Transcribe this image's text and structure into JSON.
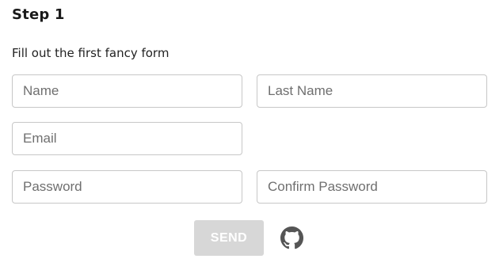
{
  "form": {
    "step_title": "Step 1",
    "subtitle": "Fill out the first fancy form",
    "fields": {
      "name": {
        "placeholder": "Name",
        "value": ""
      },
      "last_name": {
        "placeholder": "Last Name",
        "value": ""
      },
      "email": {
        "placeholder": "Email",
        "value": ""
      },
      "password": {
        "placeholder": "Password",
        "value": ""
      },
      "confirm_password": {
        "placeholder": "Confirm Password",
        "value": ""
      }
    },
    "send_label": "SEND",
    "send_disabled": true
  },
  "icons": {
    "github": "github-icon"
  },
  "colors": {
    "send_disabled_bg": "#d7d7d7",
    "field_border": "#c7c7c7",
    "github_icon": "#555555"
  }
}
